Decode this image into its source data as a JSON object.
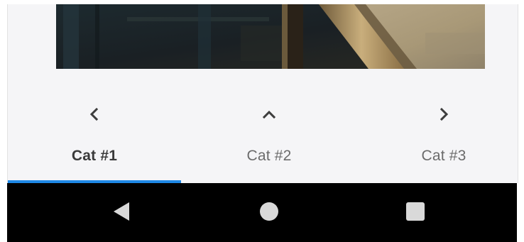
{
  "tabs": [
    {
      "label": "Cat #1",
      "icon": "chevron-left-icon",
      "selected": true
    },
    {
      "label": "Cat #2",
      "icon": "chevron-up-icon",
      "selected": false
    },
    {
      "label": "Cat #3",
      "icon": "chevron-right-icon",
      "selected": false
    }
  ],
  "nav_bar": {
    "buttons": [
      {
        "icon": "back-triangle-icon"
      },
      {
        "icon": "home-circle-icon"
      },
      {
        "icon": "recents-square-icon"
      }
    ]
  },
  "colors": {
    "tab_indicator": "#1e88e5",
    "tab_label_selected": "#3a3a3a",
    "tab_label": "#6b6b6b",
    "icon": "#3d3d3d",
    "nav_bar_background": "#000000",
    "nav_button": "#d9d9d9",
    "app_background": "#f5f5f7"
  }
}
